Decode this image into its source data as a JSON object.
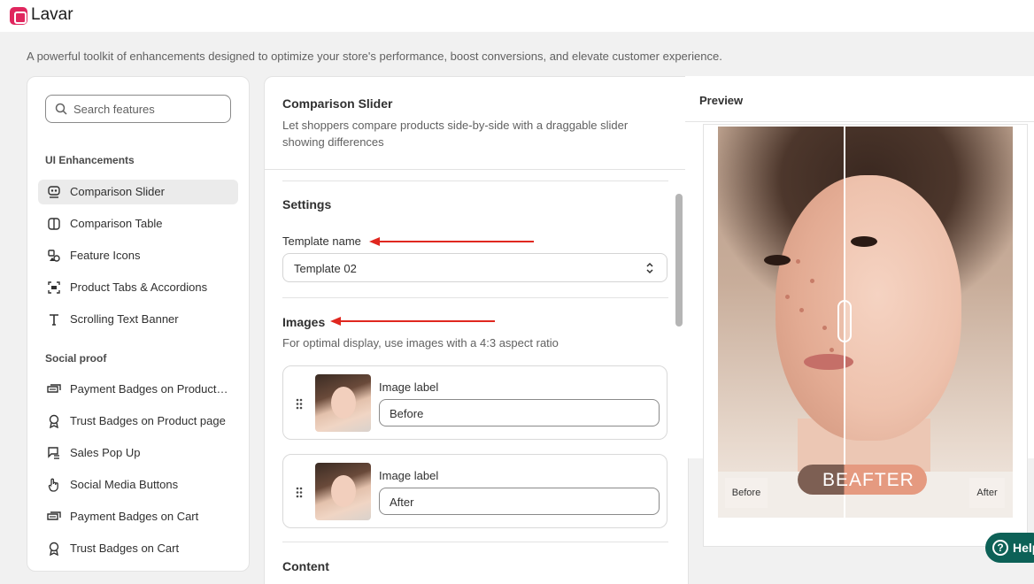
{
  "app": {
    "name": "Lavar"
  },
  "page": {
    "description": "A powerful toolkit of enhancements designed to optimize your store's performance, boost conversions, and elevate customer experience."
  },
  "sidebar": {
    "search_placeholder": "Search features",
    "sections": [
      {
        "title": "UI Enhancements",
        "items": [
          {
            "label": "Comparison Slider",
            "icon": "comparison-slider-icon",
            "active": true
          },
          {
            "label": "Comparison Table",
            "icon": "columns-icon"
          },
          {
            "label": "Feature Icons",
            "icon": "shapes-icon"
          },
          {
            "label": "Product Tabs & Accordions",
            "icon": "tabs-icon"
          },
          {
            "label": "Scrolling Text Banner",
            "icon": "text-icon"
          }
        ]
      },
      {
        "title": "Social proof",
        "items": [
          {
            "label": "Payment Badges on Product page",
            "icon": "cash-icon"
          },
          {
            "label": "Trust Badges on Product page",
            "icon": "award-icon"
          },
          {
            "label": "Sales Pop Up",
            "icon": "popup-icon"
          },
          {
            "label": "Social Media Buttons",
            "icon": "hand-pointer-icon"
          },
          {
            "label": "Payment Badges on Cart",
            "icon": "cash-icon"
          },
          {
            "label": "Trust Badges on Cart",
            "icon": "award-icon"
          }
        ]
      }
    ]
  },
  "main": {
    "title": "Comparison Slider",
    "description": "Let shoppers compare products side-by-side with a draggable slider showing differences",
    "settings": {
      "heading": "Settings",
      "template_label": "Template name",
      "template_value": "Template 02"
    },
    "images": {
      "heading": "Images",
      "hint": "For optimal display, use images with a 4:3 aspect ratio",
      "items": [
        {
          "label": "Image label",
          "value": "Before"
        },
        {
          "label": "Image label",
          "value": "After"
        }
      ]
    },
    "content_heading": "Content"
  },
  "preview": {
    "label": "Preview",
    "pill_text": "BEAFTER",
    "before_tag": "Before",
    "after_tag": "After"
  },
  "help": {
    "label": "Help"
  },
  "colors": {
    "accent": "#e0265e",
    "arrow": "#e0271f",
    "help": "#0d6157"
  }
}
